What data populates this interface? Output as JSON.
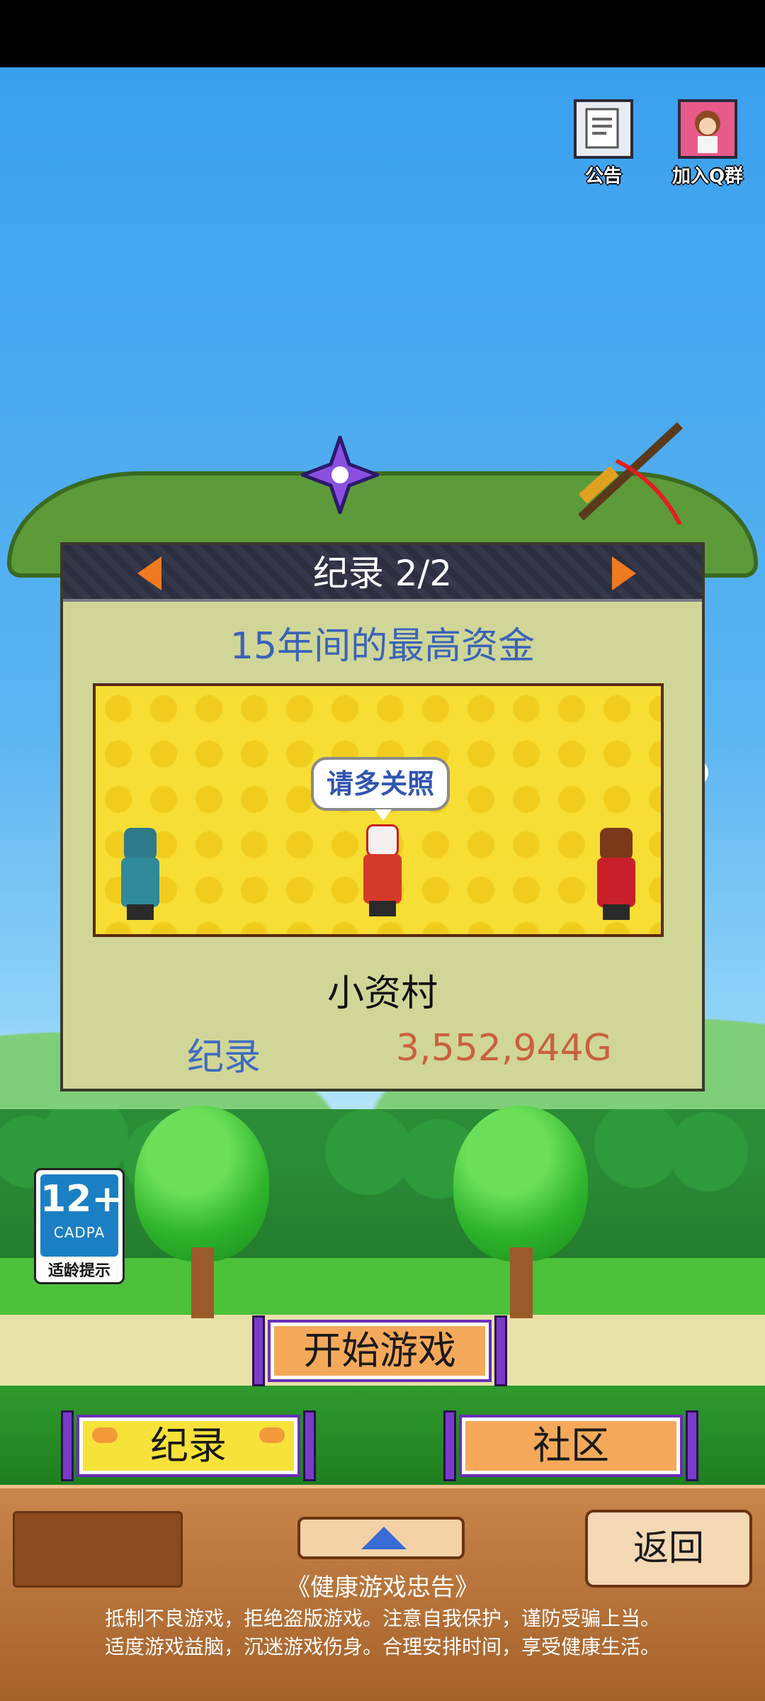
{
  "top_icons": {
    "notice_label": "公告",
    "join_group_label": "加入Q群"
  },
  "dialog": {
    "title": "纪录 2/2",
    "subtitle": "15年间的最高资金",
    "bubble_text": "请多关照",
    "village_name": "小资村",
    "record_label": "纪录",
    "record_value": "3,552,944G"
  },
  "age_rating": {
    "number": "12+",
    "org": "CADPA",
    "tip": "适龄提示"
  },
  "buttons": {
    "start_game": "开始游戏",
    "records": "纪录",
    "community": "社区",
    "back": "返回"
  },
  "health_notice": {
    "heading": "《健康游戏忠告》",
    "line1": "抵制不良游戏，拒绝盗版游戏。注意自我保护，谨防受骗上当。",
    "line2": "适度游戏益脑，沉迷游戏伤身。合理安排时间，享受健康生活。"
  },
  "colors": {
    "sky": "#3aa0ee",
    "dialog_bg": "#d0d697",
    "subtitle": "#3a63b8",
    "record_value": "#c9613e",
    "scroll_rod": "#7a3cc8"
  }
}
